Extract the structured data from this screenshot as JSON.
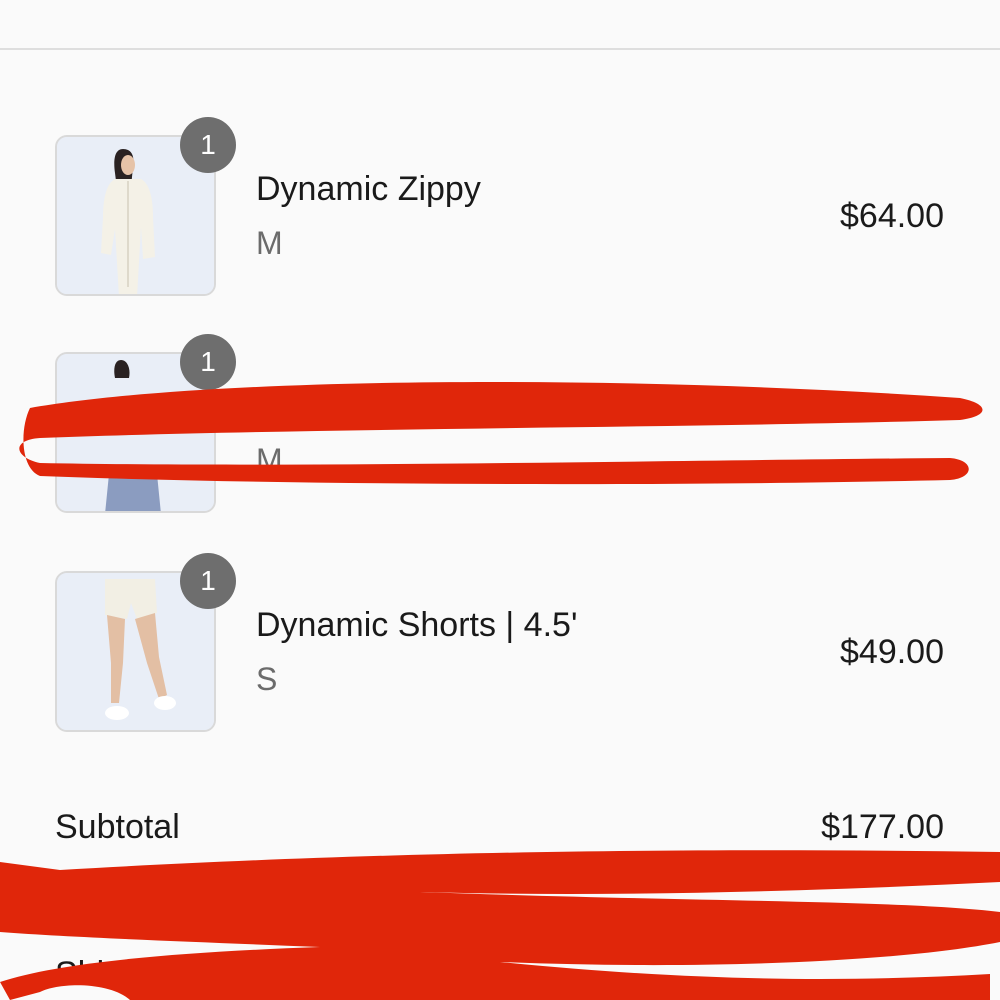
{
  "cart": {
    "items": [
      {
        "name": "Dynamic Zippy",
        "variant": "M",
        "price": "$64.00",
        "quantity": "1"
      },
      {
        "name": "",
        "variant": "M",
        "price": "",
        "quantity": "1"
      },
      {
        "name": "Dynamic Shorts | 4.5'",
        "variant": "S",
        "price": "$49.00",
        "quantity": "1"
      }
    ]
  },
  "summary": {
    "subtotal_label": "Subtotal",
    "subtotal_value": "$177.00",
    "shipping_label": "Shi"
  },
  "colors": {
    "redaction": "#e0260a",
    "badge": "#6e6e6e",
    "background": "#fafafa"
  }
}
